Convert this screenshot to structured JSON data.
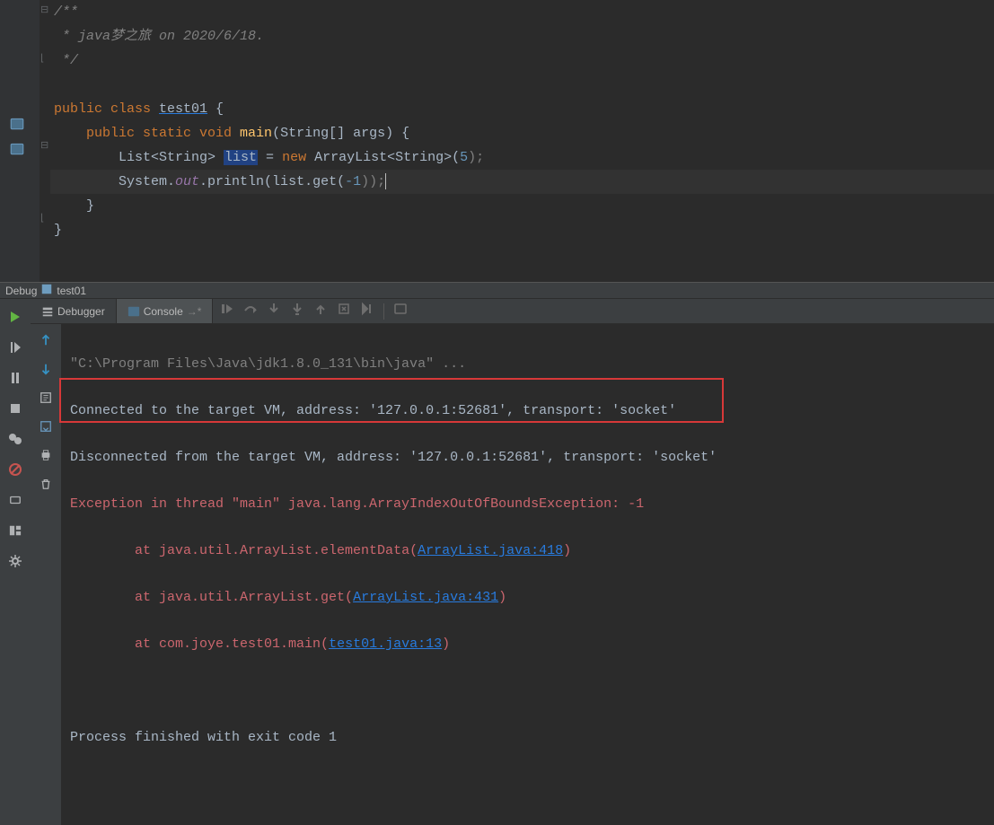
{
  "code": {
    "comment_open": "/**",
    "comment_line": " * java梦之旅 on 2020/6/18.",
    "comment_close": " */",
    "class_kw": "public class ",
    "class_name": "test01",
    "class_brace": " {",
    "main_sig_pre": "    public static void ",
    "main_name": "main",
    "main_args": "(String[] args) {",
    "list_decl_pre": "        List<String> ",
    "list_var": "list",
    "list_eq": " = ",
    "list_new": "new ",
    "list_type": "ArrayList<String>(",
    "list_num": "5",
    "list_end": ");",
    "sout_pre": "        System.",
    "sout_out": "out",
    "sout_mid": ".println(list.get(",
    "sout_num": "-1",
    "sout_end": "));",
    "close_inner": "    }",
    "close_outer": "}"
  },
  "debug_header": {
    "label": "Debug",
    "run_config": "test01"
  },
  "tabs": {
    "debugger": "Debugger",
    "console": "Console"
  },
  "console": {
    "run_cmd": "\"C:\\Program Files\\Java\\jdk1.8.0_131\\bin\\java\" ...",
    "connected": "Connected to the target VM, address: '127.0.0.1:52681', transport: 'socket'",
    "disconnected": "Disconnected from the target VM, address: '127.0.0.1:52681', transport: 'socket'",
    "exception": "Exception in thread \"main\" java.lang.ArrayIndexOutOfBoundsException: -1",
    "trace1_pre": "\tat java.util.ArrayList.elementData(",
    "trace1_link": "ArrayList.java:418",
    "trace1_post": ")",
    "trace2_pre": "\tat java.util.ArrayList.get(",
    "trace2_link": "ArrayList.java:431",
    "trace2_post": ")",
    "trace3_pre": "\tat com.joye.test01.main(",
    "trace3_link": "test01.java:13",
    "trace3_post": ")",
    "exit": "Process finished with exit code 1"
  }
}
